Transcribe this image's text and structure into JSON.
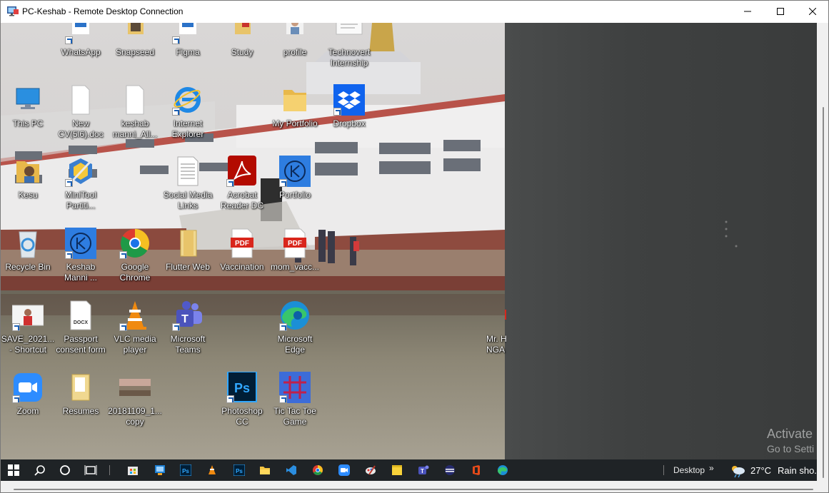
{
  "window": {
    "title": "PC-Keshab - Remote Desktop Connection"
  },
  "desktop_icons": [
    {
      "label": "WhatsApp"
    },
    {
      "label": "Snapseed"
    },
    {
      "label": "Figma"
    },
    {
      "label": "Study"
    },
    {
      "label": "profile"
    },
    {
      "line1": "Technovert",
      "line2": "Internship"
    },
    {
      "label": "This PC"
    },
    {
      "line1": "New",
      "line2": "CV(5l6).doc"
    },
    {
      "line1": "keshab",
      "line2": "manni_All..."
    },
    {
      "line1": "Internet",
      "line2": "Explorer"
    },
    {
      "label": "My Portfolio"
    },
    {
      "label": "Dropbox"
    },
    {
      "label": "Kesu"
    },
    {
      "line1": "MiniTool",
      "line2": "Partiti..."
    },
    {
      "line1": "Social Media",
      "line2": "Links"
    },
    {
      "line1": "Acrobat",
      "line2": "Reader DC"
    },
    {
      "label": "Portfolio"
    },
    {
      "label": "Recycle Bin"
    },
    {
      "line1": "Keshab",
      "line2": "Manni ..."
    },
    {
      "line1": "Google",
      "line2": "Chrome"
    },
    {
      "label": "Flutter Web"
    },
    {
      "label": "Vaccination"
    },
    {
      "label": "mom_vacc..."
    },
    {
      "line1": "SAVE_2021...",
      "line2": "- Shortcut"
    },
    {
      "line1": "Passport",
      "line2": "consent form"
    },
    {
      "line1": "VLC media",
      "line2": "player"
    },
    {
      "line1": "Microsoft",
      "line2": "Teams"
    },
    {
      "line1": "Microsoft",
      "line2": "Edge"
    },
    {
      "line1": "Mr. H",
      "line2": "NGA"
    },
    {
      "label": "Zoom"
    },
    {
      "label": "Resumes"
    },
    {
      "line1": "20181109_1...",
      "line2": "copy"
    },
    {
      "line1": "Photoshop",
      "line2": "CC"
    },
    {
      "line1": "Tic Tac Toe",
      "line2": "Game"
    }
  ],
  "watermark": {
    "line1": "Activate",
    "line2": "Go to Setti"
  },
  "taskbar": {
    "desktop_label": "Desktop",
    "chevron": "»",
    "temperature": "27°C",
    "weather": "Rain sho..."
  },
  "colors": {
    "taskbar_bg": "#1f2326",
    "accent": "#0078d4"
  }
}
